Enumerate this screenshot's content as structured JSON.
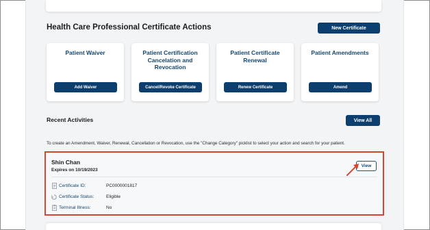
{
  "actions": {
    "title": "Health Care Professional Certificate Actions",
    "new_certificate_label": "New Certificate",
    "cards": [
      {
        "title": "Patient Waiver",
        "button": "Add Waiver"
      },
      {
        "title": "Patient Certification Cancelation and Revocation",
        "button": "Cancel/Revoke Certificate"
      },
      {
        "title": "Patient Certificate Renewal",
        "button": "Renew Certificate"
      },
      {
        "title": "Patient Amendments",
        "button": "Amend"
      }
    ]
  },
  "recent": {
    "title": "Recent Activities",
    "view_all_label": "View All",
    "instructions": "To create an Amendment, Waiver, Renewal, Cancellation or Revocation, use the \"Change Category\" picklist to select your action and search for your patient.",
    "activity": {
      "name": "Shin Chan",
      "expires": "Expires on 10/19/2023",
      "view_label": "View",
      "details": [
        {
          "label": "Certificate ID:",
          "value": "PC0000001817",
          "icon": "document-icon"
        },
        {
          "label": "Certificate Status:",
          "value": "Eligible",
          "icon": "status-icon"
        },
        {
          "label": "Terminal Illness:",
          "value": "No",
          "icon": "clipboard-icon"
        }
      ]
    }
  },
  "colors": {
    "primary": "#0d3f6e",
    "highlight": "#d6452e",
    "link_text": "#14466f",
    "page_bg": "#f3f4f6"
  }
}
